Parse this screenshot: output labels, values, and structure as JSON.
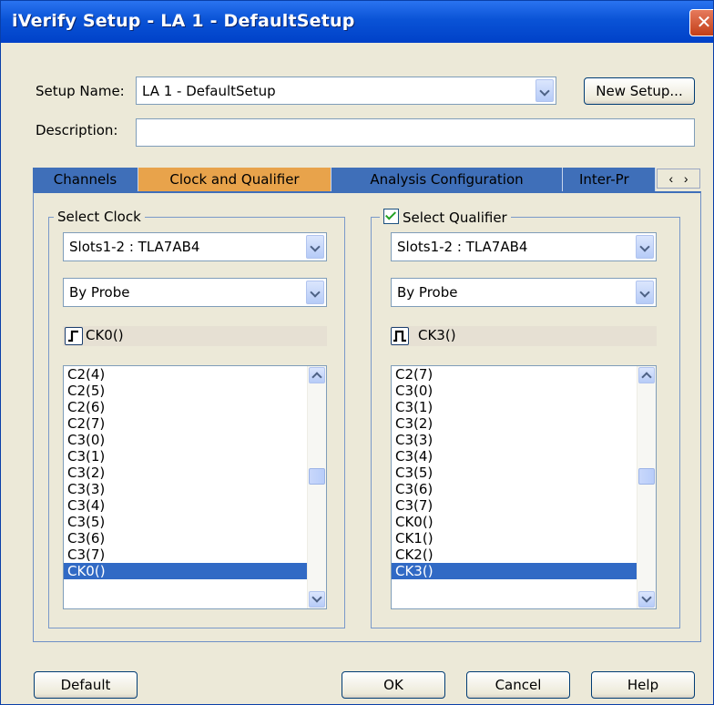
{
  "window": {
    "title": "iVerify Setup - LA 1 - DefaultSetup",
    "close_glyph": "✕"
  },
  "setup": {
    "name_label": "Setup Name:",
    "name_value": "LA 1 - DefaultSetup",
    "new_setup_label": "New Setup...",
    "description_label": "Description:",
    "description_value": ""
  },
  "tabs": [
    {
      "label": "Channels",
      "active": false
    },
    {
      "label": "Clock and Qualifier",
      "active": true
    },
    {
      "label": "Analysis Configuration",
      "active": false
    },
    {
      "label": "Inter-Pr",
      "active": false
    }
  ],
  "tab_scroll": {
    "left": "‹",
    "right": "›"
  },
  "select_clock": {
    "title": "Select Clock",
    "module": "Slots1-2 : TLA7AB4",
    "mode": "By Probe",
    "edge_icon": "rising-edge-icon",
    "current": "CK0()",
    "items": [
      "C2(4)",
      "C2(5)",
      "C2(6)",
      "C2(7)",
      "C3(0)",
      "C3(1)",
      "C3(2)",
      "C3(3)",
      "C3(4)",
      "C3(5)",
      "C3(6)",
      "C3(7)",
      "CK0()"
    ],
    "selected": "CK0()"
  },
  "select_qualifier": {
    "title": "Select Qualifier",
    "checked": true,
    "module": "Slots1-2 : TLA7AB4",
    "mode": "By Probe",
    "edge_icon": "pulse-high-icon",
    "current": "CK3()",
    "items": [
      "C2(7)",
      "C3(0)",
      "C3(1)",
      "C3(2)",
      "C3(3)",
      "C3(4)",
      "C3(5)",
      "C3(6)",
      "C3(7)",
      "CK0()",
      "CK1()",
      "CK2()",
      "CK3()"
    ],
    "selected": "CK3()"
  },
  "buttons": {
    "default": "Default",
    "ok": "OK",
    "cancel": "Cancel",
    "help": "Help"
  },
  "colors": {
    "titlebar": "#0a53d6",
    "tab_active": "#e8a34b",
    "tab_inactive": "#3f6fb9",
    "list_selection": "#316ac5"
  }
}
